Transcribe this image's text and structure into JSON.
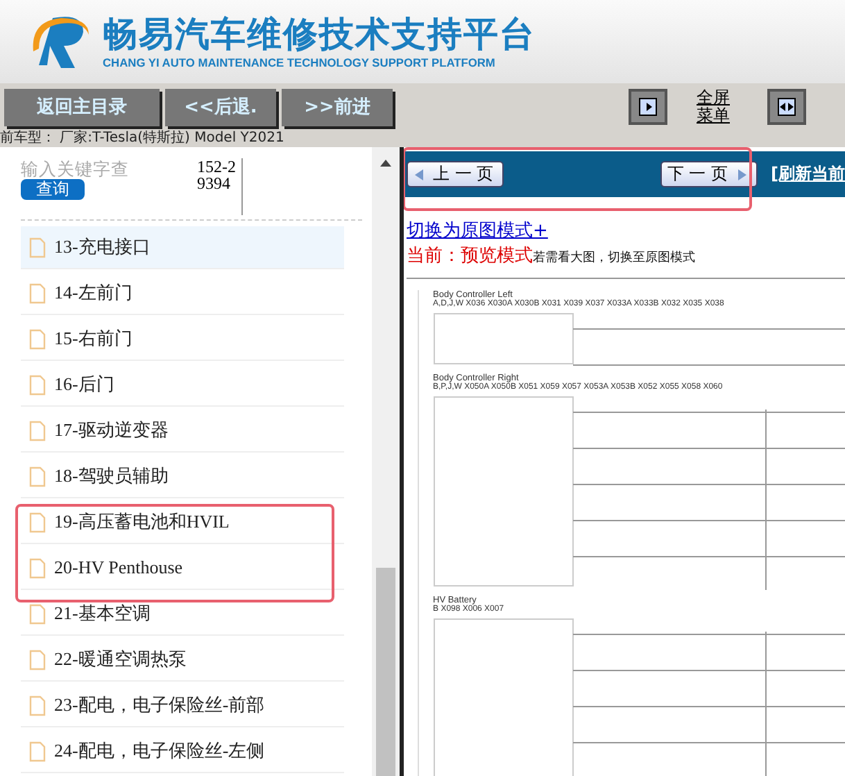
{
  "header": {
    "title": "畅易汽车维修技术支持平台",
    "subtitle": "CHANG YI AUTO MAINTENANCE TECHNOLOGY SUPPORT PLATFORM"
  },
  "toolbar": {
    "buttons": [
      "返回主目录",
      "<<后退.",
      ">>前进"
    ],
    "fullscreen_label": [
      "全屏",
      "菜单"
    ]
  },
  "vehicle_info": "前车型：  厂家:T-Tesla(特斯拉) Model Y2021",
  "search": {
    "placeholder": "输入关键字查",
    "code": "152-29394",
    "button": "查询"
  },
  "menu": [
    {
      "label": "13-充电接口",
      "selected": true
    },
    {
      "label": "14-左前门",
      "selected": false
    },
    {
      "label": "15-右前门",
      "selected": false
    },
    {
      "label": "16-后门",
      "selected": false
    },
    {
      "label": "17-驱动逆变器",
      "selected": false
    },
    {
      "label": "18-驾驶员辅助",
      "selected": false
    },
    {
      "label": "19-高压蓄电池和HVIL",
      "selected": false
    },
    {
      "label": "20-HV Penthouse",
      "selected": false
    },
    {
      "label": "21-基本空调",
      "selected": false
    },
    {
      "label": "22-暖通空调热泵",
      "selected": false
    },
    {
      "label": "23-配电，电子保险丝-前部",
      "selected": false
    },
    {
      "label": "24-配电，电子保险丝-左侧",
      "selected": false
    }
  ],
  "pager": {
    "prev": "上 一 页",
    "next": "下 一 页",
    "refresh": "[刷新当前"
  },
  "mode": {
    "switch_link": "切换为原图模式+",
    "current_label": "当前：",
    "current_mode": "预览模式",
    "hint": "若需看大图，切换至原图模式"
  },
  "diagram": {
    "groups": [
      {
        "title": "Body Controller Left",
        "pins": "A,D,J,W",
        "connectors": "X036  X030A  X030B  X031  X039  X037  X033A  X033B  X032  X035  X038"
      },
      {
        "title": "Body Controller Right",
        "pins": "B,P,J,W",
        "connectors": "X050A  X050B  X051  X059  X057  X053A  X053B  X052  X055  X058  X060"
      },
      {
        "title": "HV Battery",
        "pins": "B",
        "connectors": "X098  X006  X007"
      }
    ]
  }
}
